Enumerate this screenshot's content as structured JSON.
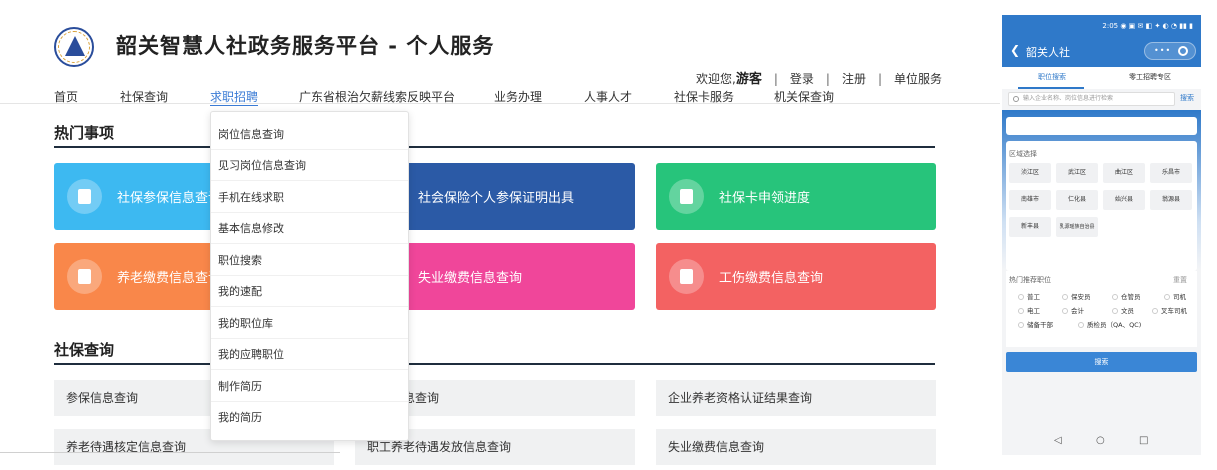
{
  "header": {
    "title": "韶关智慧人社政务服务平台 - 个人服务",
    "welcome": "欢迎您,",
    "user": "游客",
    "links": [
      "登录",
      "注册",
      "单位服务"
    ]
  },
  "nav": [
    "首页",
    "社保查询",
    "求职招聘",
    "广东省根治欠薪线索反映平台",
    "业务办理",
    "人事人才",
    "社保卡服务",
    "机关保查询"
  ],
  "dropdown": [
    "岗位信息查询",
    "见习岗位信息查询",
    "手机在线求职",
    "基本信息修改",
    "职位搜索",
    "我的速配",
    "我的职位库",
    "我的应聘职位",
    "制作简历",
    "我的简历"
  ],
  "hot": {
    "title": "热门事项",
    "cards": [
      {
        "label": "社保参保信息查询",
        "color": "#3db9f1",
        "icon": "list-icon"
      },
      {
        "label": "社会保险个人参保证明出具",
        "color": "#2b5aa6",
        "icon": "certificate-icon"
      },
      {
        "label": "社保卡申领进度",
        "color": "#27c47b",
        "icon": "card-icon"
      },
      {
        "label": "养老缴费信息查询",
        "color": "#f9874a",
        "icon": "document-icon"
      },
      {
        "label": "失业缴费信息查询",
        "color": "#f0469a",
        "icon": "document-icon"
      },
      {
        "label": "工伤缴费信息查询",
        "color": "#f36262",
        "icon": "monitor-icon"
      }
    ]
  },
  "social": {
    "title": "社保查询",
    "items": [
      "参保信息查询",
      "缴费信息查询",
      "企业养老资格认证结果查询",
      "养老待遇核定信息查询",
      "职工养老待遇发放信息查询",
      "失业缴费信息查询"
    ]
  },
  "phone": {
    "status": "2:05 ◉ ▣ ✉ ◧ ✦ ◐ ◔ ▮▮ ▮",
    "title": "韶关人社",
    "capsule_dots": "•••",
    "tabs": [
      "职位搜索",
      "零工招聘专区"
    ],
    "search_placeholder": "输入企业名称、岗位信息进行检索",
    "search_btn": "搜索",
    "region_label": "区域选择",
    "regions": [
      "浈江区",
      "武江区",
      "曲江区",
      "乐昌市",
      "南雄市",
      "仁化县",
      "始兴县",
      "翁源县",
      "新丰县",
      "乳源瑶族自治县"
    ],
    "hot_label": "热门推荐职位",
    "reset": "重置",
    "jobs": [
      "普工",
      "保安员",
      "仓管员",
      "司机",
      "电工",
      "会计",
      "文员",
      "叉车司机",
      "储备干部",
      "质检员（QA、QC)"
    ],
    "submit": "搜索",
    "nav_icons": [
      "◁",
      "○",
      "□"
    ]
  },
  "accent": "#3a7bd5"
}
